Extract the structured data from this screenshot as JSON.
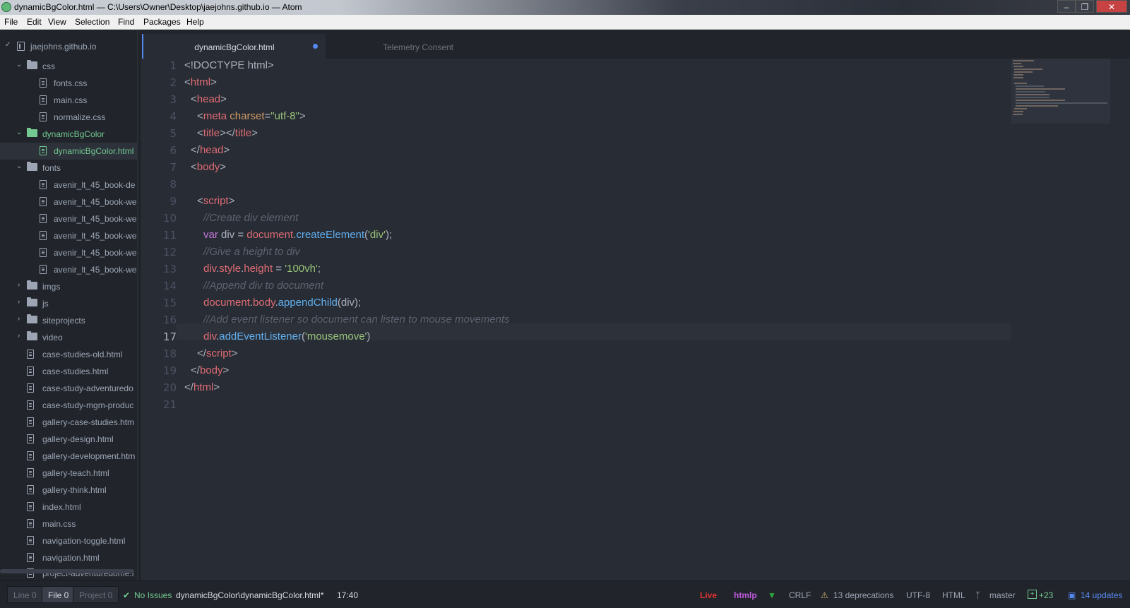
{
  "window": {
    "title": "dynamicBgColor.html — C:\\Users\\Owner\\Desktop\\jaejohns.github.io — Atom",
    "controls": {
      "minimize": "–",
      "maximize": "❐",
      "close": "✕"
    }
  },
  "menu": [
    "File",
    "Edit",
    "View",
    "Selection",
    "Find",
    "Packages",
    "Help"
  ],
  "tree": {
    "root": "jaejohns.github.io",
    "css_folder": "css",
    "css_files": [
      "fonts.css",
      "main.css",
      "normalize.css"
    ],
    "dynamic_folder": "dynamicBgColor",
    "dynamic_file": "dynamicBgColor.html",
    "fonts_folder": "fonts",
    "font_files": [
      "avenir_lt_45_book-de",
      "avenir_lt_45_book-we",
      "avenir_lt_45_book-we",
      "avenir_lt_45_book-we",
      "avenir_lt_45_book-we",
      "avenir_lt_45_book-we"
    ],
    "collapsed_folders": [
      "imgs",
      "js",
      "siteprojects",
      "video"
    ],
    "root_files": [
      "case-studies-old.html",
      "case-studies.html",
      "case-study-adventuredo",
      "case-study-mgm-produc",
      "gallery-case-studies.htm",
      "gallery-design.html",
      "gallery-development.htm",
      "gallery-teach.html",
      "gallery-think.html",
      "index.html",
      "main.css",
      "navigation-toggle.html",
      "navigation.html",
      "project-adventuredome.l"
    ]
  },
  "tabs": {
    "active": "dynamicBgColor.html",
    "inactive": "Telemetry Consent"
  },
  "editor": {
    "line_numbers": [
      "1",
      "2",
      "3",
      "4",
      "5",
      "6",
      "7",
      "8",
      "9",
      "10",
      "11",
      "12",
      "13",
      "14",
      "15",
      "16",
      "17",
      "18",
      "19",
      "20",
      "21"
    ],
    "current_line": "17",
    "code": {
      "l1": "<!DOCTYPE html>",
      "l2a": "<",
      "l2b": "html",
      "l2c": ">",
      "l3a": "<",
      "l3b": "head",
      "l3c": ">",
      "l4a": "<",
      "l4b": "meta",
      "l4c": " charset",
      "l4d": "=",
      "l4e": "\"utf-8\"",
      "l4f": ">",
      "l5a": "<",
      "l5b": "title",
      "l5c": "></",
      "l5d": "title",
      "l5e": ">",
      "l6a": "</",
      "l6b": "head",
      "l6c": ">",
      "l7a": "<",
      "l7b": "body",
      "l7c": ">",
      "l9a": "<",
      "l9b": "script",
      "l9c": ">",
      "l10": "//Create div element",
      "l11a": "var",
      "l11b": " div = ",
      "l11c": "document",
      "l11d": ".",
      "l11e": "createElement",
      "l11f": "(",
      "l11g": "'div'",
      "l11h": ");",
      "l12": "//Give a height to div",
      "l13a": "div",
      "l13b": ".",
      "l13c": "style",
      "l13d": ".",
      "l13e": "height",
      "l13f": " = ",
      "l13g": "'100vh'",
      "l13h": ";",
      "l14": "//Append div to document",
      "l15a": "document",
      "l15b": ".",
      "l15c": "body",
      "l15d": ".",
      "l15e": "appendChild",
      "l15f": "(div);",
      "l16": "//Add event listener so document can listen to mouse movements",
      "l17a": "div",
      "l17b": ".",
      "l17c": "addEventListener",
      "l17d": "(",
      "l17e": "'mousemove'",
      "l17f": ")",
      "l18a": "</",
      "l18b": "script",
      "l18c": ">",
      "l19a": "</",
      "l19b": "body",
      "l19c": ">",
      "l20a": "</",
      "l20b": "html",
      "l20c": ">"
    }
  },
  "status": {
    "line_tab": "Line 0",
    "file_tab": "File 0",
    "project_tab": "Project 0",
    "no_issues": "No Issues",
    "path": "dynamicBgColor\\dynamicBgColor.html*",
    "cursor": "17:40",
    "live": "Live",
    "grammar_preview": "htmlp",
    "line_ending": "CRLF",
    "deprecations": "13 deprecations",
    "encoding": "UTF-8",
    "grammar": "HTML",
    "branch": "master",
    "diff": "+23",
    "updates": "14 updates"
  },
  "colors": {
    "accent": "#568af2",
    "git_added": "#73c990",
    "live_red": "#e03030",
    "htmlp_purple": "#c05ae0"
  }
}
